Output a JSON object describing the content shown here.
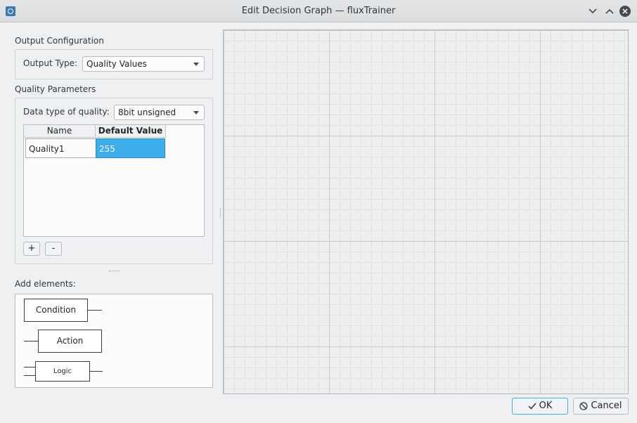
{
  "window": {
    "title": "Edit Decision Graph — fluxTrainer"
  },
  "output_configuration": {
    "heading": "Output Configuration",
    "output_type_label": "Output Type:",
    "output_type_value": "Quality Values"
  },
  "quality_parameters": {
    "heading": "Quality Parameters",
    "data_type_label": "Data type of quality:",
    "data_type_value": "8bit unsigned",
    "table": {
      "columns": [
        "Name",
        "Default Value"
      ],
      "rows": [
        {
          "name": "Quality1",
          "default_value": "255"
        }
      ]
    },
    "add_label": "+",
    "remove_label": "-"
  },
  "add_elements": {
    "heading": "Add elements:",
    "items": [
      "Condition",
      "Action",
      "Logic"
    ]
  },
  "buttons": {
    "ok_label": "OK",
    "cancel_label": "Cancel"
  },
  "colors": {
    "selection": "#3daee9",
    "canvas_background": "#eeefef"
  }
}
